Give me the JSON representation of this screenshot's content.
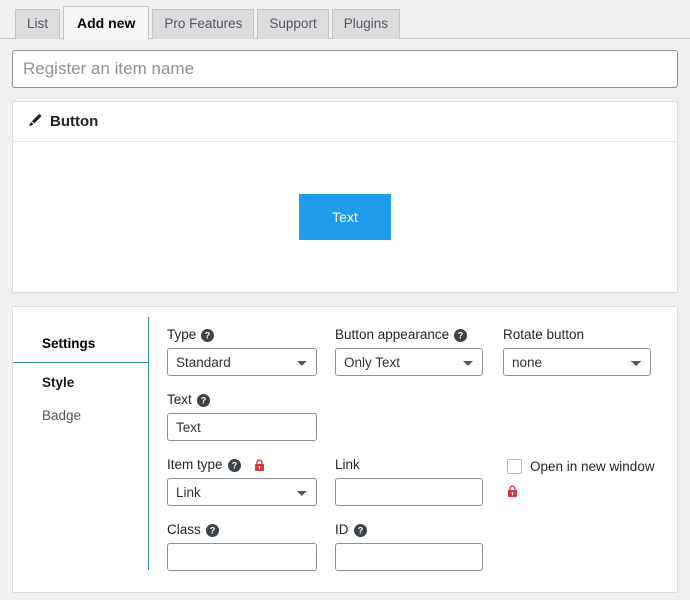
{
  "tabs": [
    {
      "label": "List",
      "active": false
    },
    {
      "label": "Add new",
      "active": true
    },
    {
      "label": "Pro Features",
      "active": false
    },
    {
      "label": "Support",
      "active": false
    },
    {
      "label": "Plugins",
      "active": false
    }
  ],
  "name_field": {
    "value": "",
    "placeholder": "Register an item name"
  },
  "preview": {
    "icon": "brush-icon",
    "title": "Button",
    "button_label": "Text",
    "button_color": "#1e9be9",
    "button_text_color": "#ffffff"
  },
  "settings": {
    "side_tabs": [
      {
        "label": "Settings",
        "active": true
      },
      {
        "label": "Style",
        "active": false
      },
      {
        "label": "Badge",
        "active": false
      }
    ],
    "accent_color": "#2b89b5",
    "lock_color": "#d63638",
    "fields": {
      "type": {
        "label": "Type",
        "value": "Standard",
        "options": [
          "Standard"
        ],
        "help": "help-icon"
      },
      "button_appearance": {
        "label": "Button appearance",
        "value": "Only Text",
        "options": [
          "Only Text"
        ],
        "help": "help-icon"
      },
      "rotate_button": {
        "label": "Rotate button",
        "value": "none",
        "options": [
          "none"
        ]
      },
      "text": {
        "label": "Text",
        "value": "Text",
        "placeholder": "",
        "help": "help-icon"
      },
      "item_type": {
        "label": "Item type",
        "value": "Link",
        "options": [
          "Link"
        ],
        "help": "help-icon",
        "locked": true
      },
      "link": {
        "label": "Link",
        "value": "",
        "placeholder": ""
      },
      "open_new_window": {
        "label": "Open in new window",
        "checked": false,
        "locked": true
      },
      "class": {
        "label": "Class",
        "value": "",
        "placeholder": "",
        "help": "help-icon"
      },
      "id": {
        "label": "ID",
        "value": "",
        "placeholder": "",
        "help": "help-icon"
      }
    }
  }
}
